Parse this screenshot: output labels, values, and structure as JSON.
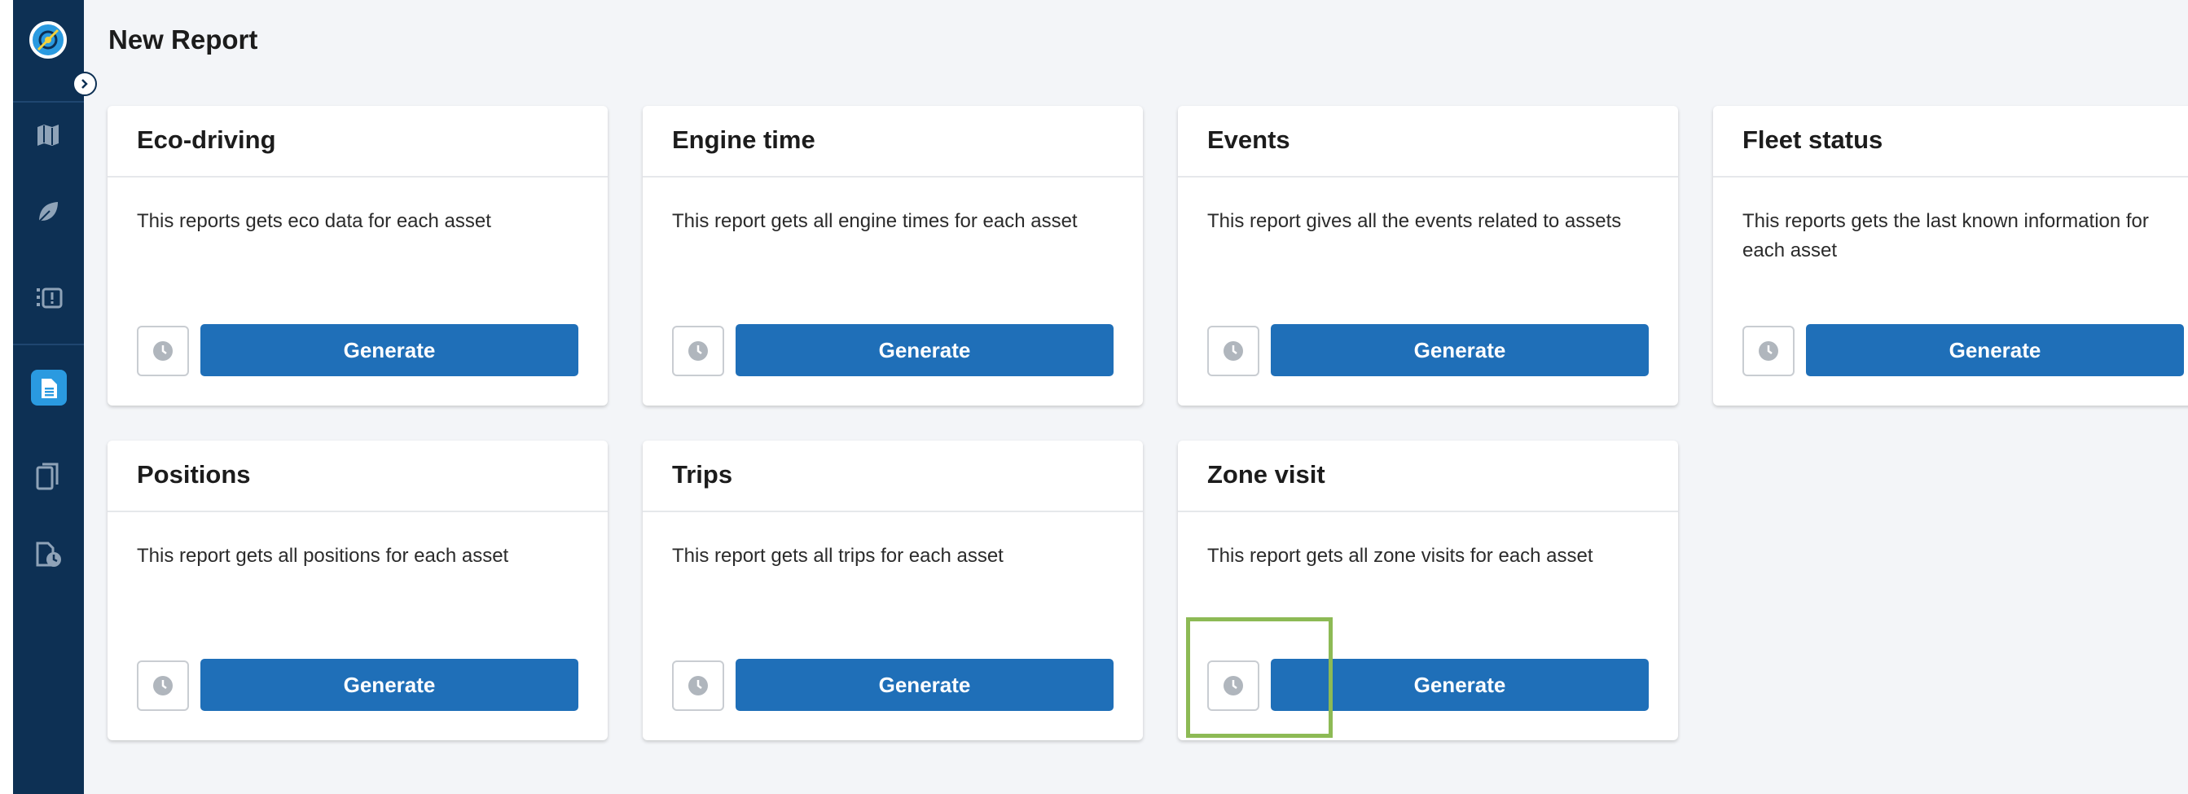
{
  "page": {
    "title": "New Report"
  },
  "sidebar": {
    "items": [
      {
        "name": "map",
        "icon": "map-icon"
      },
      {
        "name": "eco",
        "icon": "leaf-icon"
      },
      {
        "name": "alerts",
        "icon": "alert-list-icon"
      },
      {
        "name": "new-report",
        "icon": "report-icon",
        "active": true
      },
      {
        "name": "reports",
        "icon": "documents-icon"
      },
      {
        "name": "scheduled-reports",
        "icon": "scheduled-report-icon"
      }
    ]
  },
  "cards": [
    {
      "title": "Eco-driving",
      "description": "This reports gets eco data for each asset",
      "generate_label": "Generate"
    },
    {
      "title": "Engine time",
      "description": "This report gets all engine times for each asset",
      "generate_label": "Generate"
    },
    {
      "title": "Events",
      "description": "This report gives all the events related to assets",
      "generate_label": "Generate"
    },
    {
      "title": "Fleet status",
      "description": "This reports gets the last known information for each asset",
      "generate_label": "Generate"
    },
    {
      "title": "Positions",
      "description": "This report gets all positions for each asset",
      "generate_label": "Generate"
    },
    {
      "title": "Trips",
      "description": "This report gets all trips for each asset",
      "generate_label": "Generate"
    },
    {
      "title": "Zone visit",
      "description": "This report gets all zone visits for each asset",
      "generate_label": "Generate"
    }
  ],
  "colors": {
    "sidebar_bg": "#0d3054",
    "accent": "#2a9ae0",
    "generate_button": "#1f6fb8",
    "highlight": "#8dba55"
  }
}
